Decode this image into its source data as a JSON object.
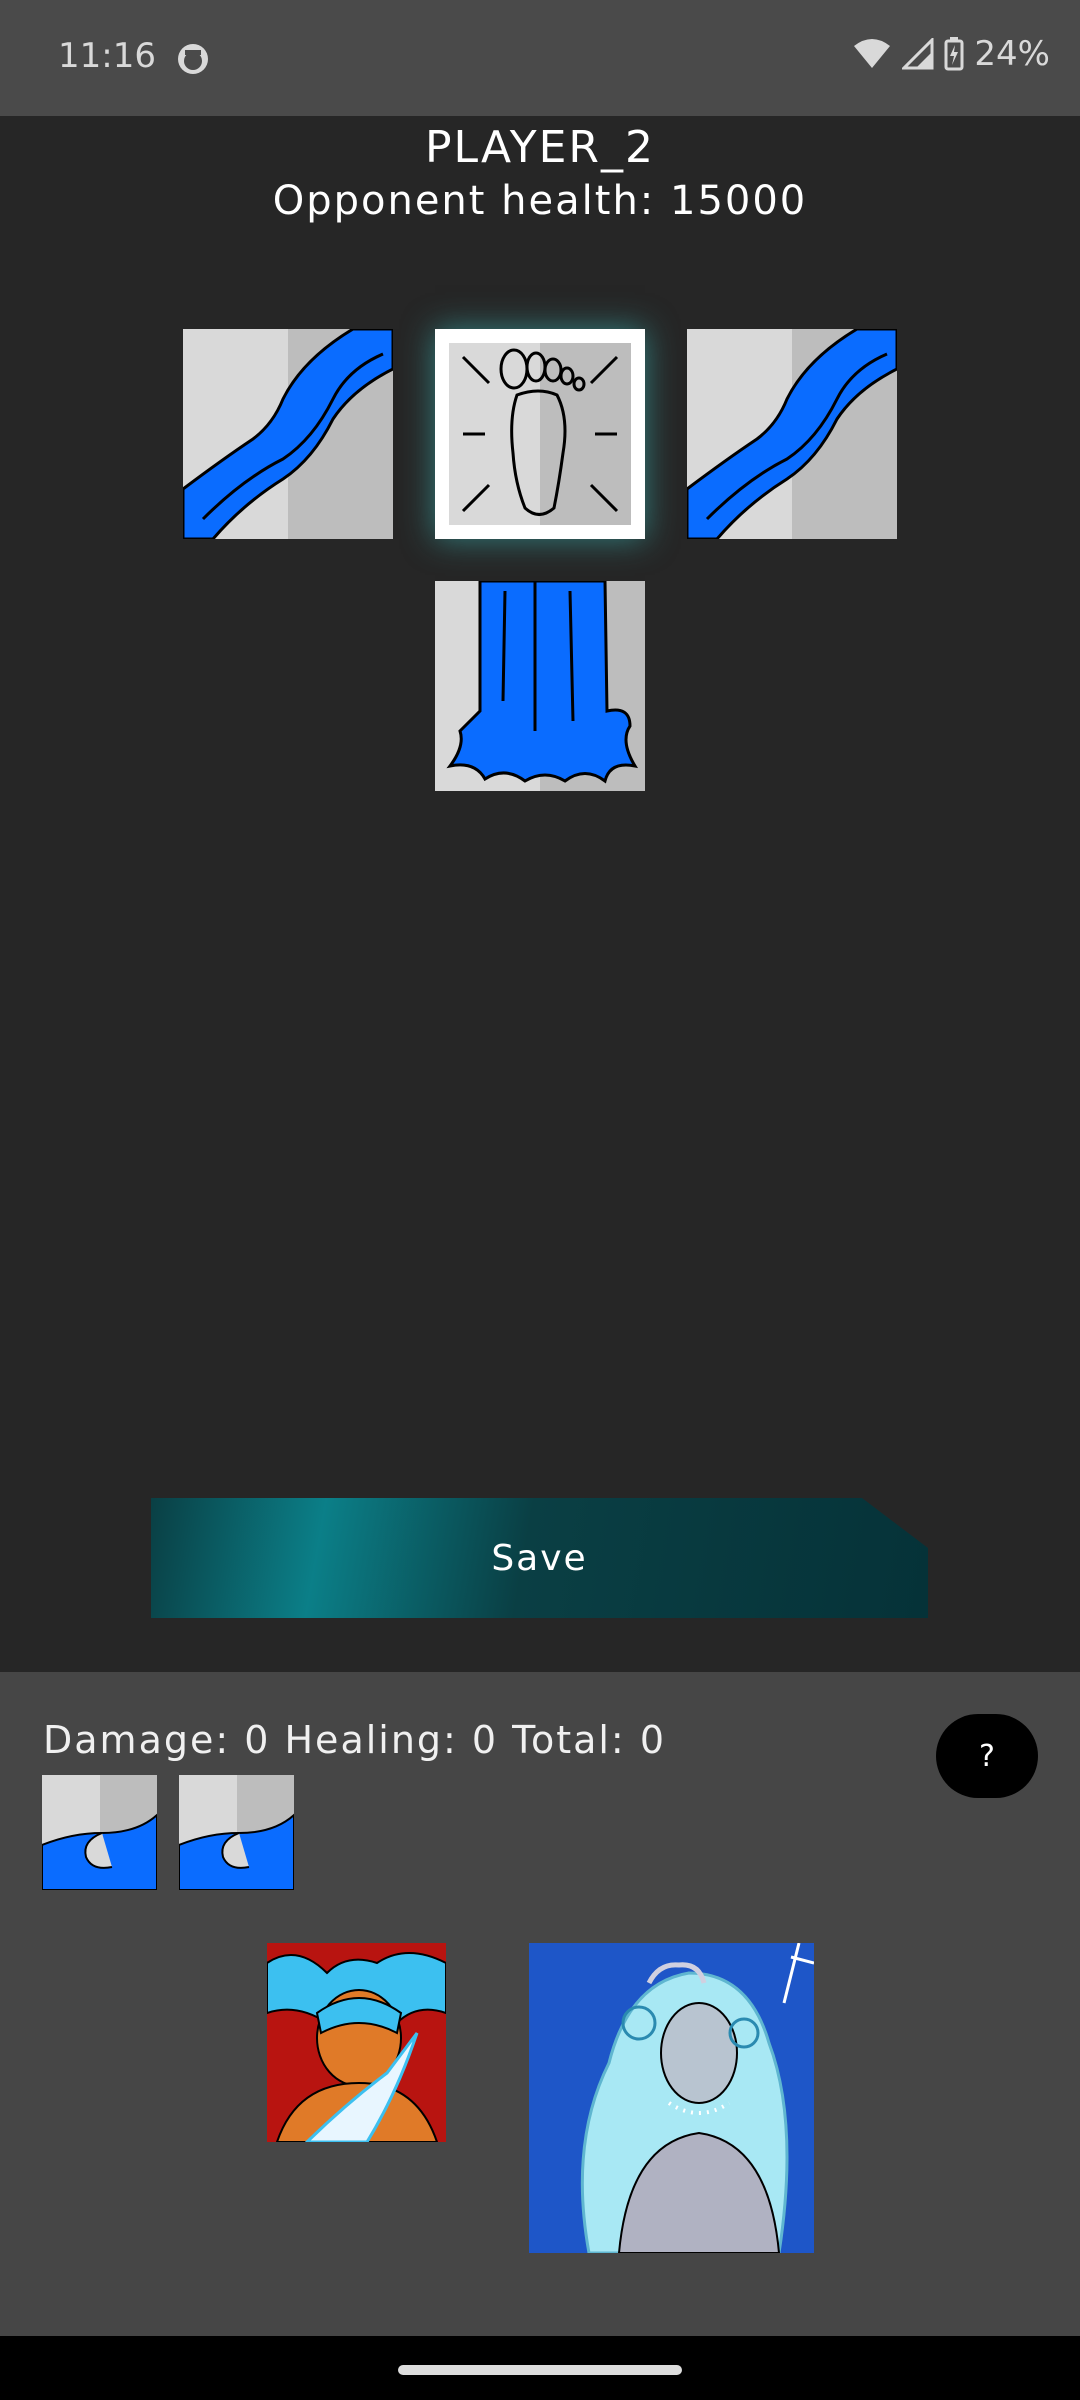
{
  "status_bar": {
    "time": "11:16",
    "battery": "24%"
  },
  "header": {
    "player_name": "PLAYER_2",
    "opponent_health": "Opponent health: 15000"
  },
  "board": {
    "tiles": [
      {
        "icon": "river-icon",
        "selected": false
      },
      {
        "icon": "footprint-icon",
        "selected": true
      },
      {
        "icon": "river-icon",
        "selected": false
      },
      {
        "icon": "waterfall-icon",
        "selected": false
      }
    ]
  },
  "save_label": "Save",
  "stats": {
    "line": "Damage: 0 Healing: 0 Total: 0"
  },
  "help_label": "?",
  "hand": [
    {
      "icon": "wave-icon"
    },
    {
      "icon": "wave-icon"
    }
  ],
  "portraits": [
    {
      "icon": "water-warrior-portrait"
    },
    {
      "icon": "ice-queen-portrait"
    }
  ],
  "colors": {
    "water": "#0a6cff",
    "accent": "#0b7f88",
    "background": "#262626",
    "panel": "#464646"
  }
}
